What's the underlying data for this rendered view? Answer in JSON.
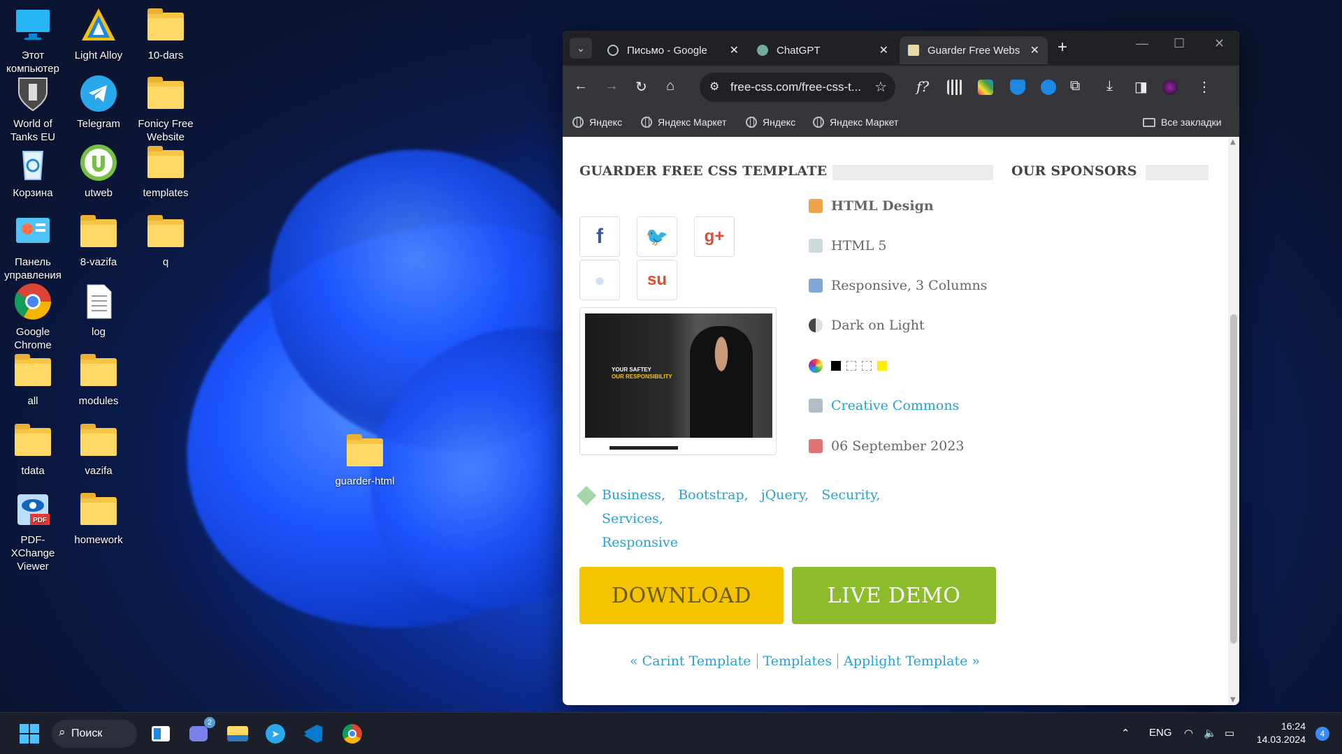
{
  "desktop": {
    "icons": [
      {
        "label": "Этот компьютер"
      },
      {
        "label": "Light Alloy"
      },
      {
        "label": "10-dars"
      },
      {
        "label": "World of Tanks EU"
      },
      {
        "label": "Telegram"
      },
      {
        "label": "Fonicy Free Website"
      },
      {
        "label": "Корзина"
      },
      {
        "label": "utweb"
      },
      {
        "label": "templates"
      },
      {
        "label": "Панель управления"
      },
      {
        "label": "8-vazifa"
      },
      {
        "label": "q"
      },
      {
        "label": "Google Chrome"
      },
      {
        "label": "log"
      },
      {
        "label": "all"
      },
      {
        "label": "modules"
      },
      {
        "label": "tdata"
      },
      {
        "label": "vazifa"
      },
      {
        "label": "PDF-XChange Viewer"
      },
      {
        "label": "homework"
      },
      {
        "label": "guarder-html"
      }
    ]
  },
  "browser": {
    "tabs": [
      {
        "title": "Письмо - Google",
        "active": false
      },
      {
        "title": "ChatGPT",
        "active": false
      },
      {
        "title": "Guarder Free Webs",
        "active": true
      }
    ],
    "url": "free-css.com/free-css-t...",
    "bookmarks": [
      "Яндекс",
      "Яндекс Маркет",
      "Яндекс",
      "Яндекс Маркет"
    ],
    "all_bookmarks": "Все закладки"
  },
  "page": {
    "heading": "GUARDER FREE CSS TEMPLATE",
    "sponsors_heading": "OUR SPONSORS",
    "thumb_line1": "YOUR SAFTEY",
    "thumb_line2": "OUR RESPONSIBILITY",
    "meta": {
      "design": "HTML Design",
      "version": "HTML 5",
      "layout": "Responsive, 3 Columns",
      "theme": "Dark on Light",
      "license": "Creative Commons",
      "date": "06 September 2023"
    },
    "swatch_colors": [
      "#000000",
      "#ffffff",
      "#ffffff",
      "#ffee00"
    ],
    "tags": [
      "Business,",
      "Bootstrap,",
      "jQuery,",
      "Security,",
      "Services,",
      "Responsive"
    ],
    "download_label": "DOWNLOAD",
    "demo_label": "LIVE DEMO",
    "pager": {
      "prev": "« Carint Template",
      "middle": "Templates",
      "next": "Applight Template »"
    }
  },
  "taskbar": {
    "search_label": "Поиск",
    "teams_badge": "2",
    "lang": "ENG",
    "time": "16:24",
    "date": "14.03.2024",
    "notifications": "4"
  }
}
